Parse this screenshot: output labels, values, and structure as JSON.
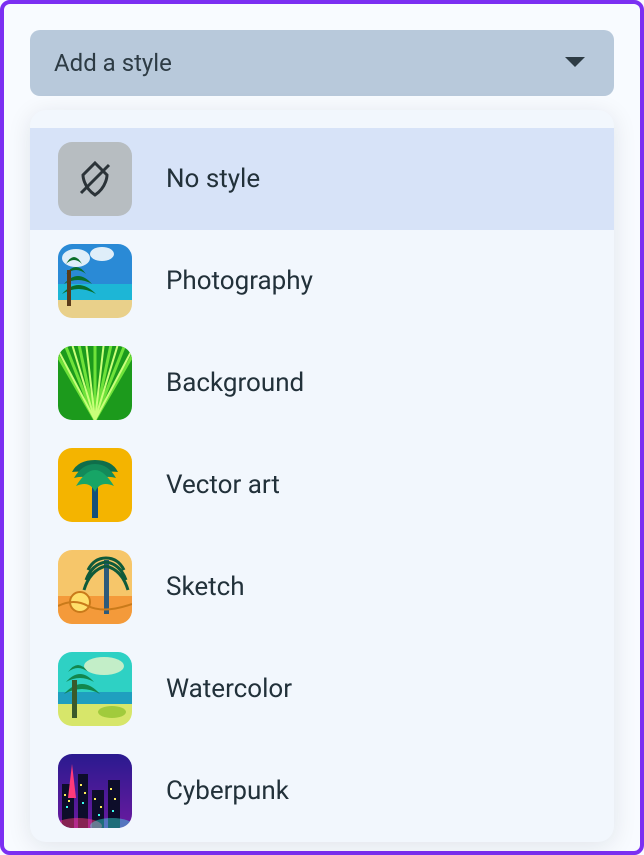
{
  "style_selector": {
    "trigger_label": "Add a style",
    "options": [
      {
        "id": "none",
        "label": "No style",
        "selected": true
      },
      {
        "id": "photography",
        "label": "Photography",
        "selected": false
      },
      {
        "id": "background",
        "label": "Background",
        "selected": false
      },
      {
        "id": "vector",
        "label": "Vector art",
        "selected": false
      },
      {
        "id": "sketch",
        "label": "Sketch",
        "selected": false
      },
      {
        "id": "watercolor",
        "label": "Watercolor",
        "selected": false
      },
      {
        "id": "cyberpunk",
        "label": "Cyberpunk",
        "selected": false
      }
    ]
  }
}
